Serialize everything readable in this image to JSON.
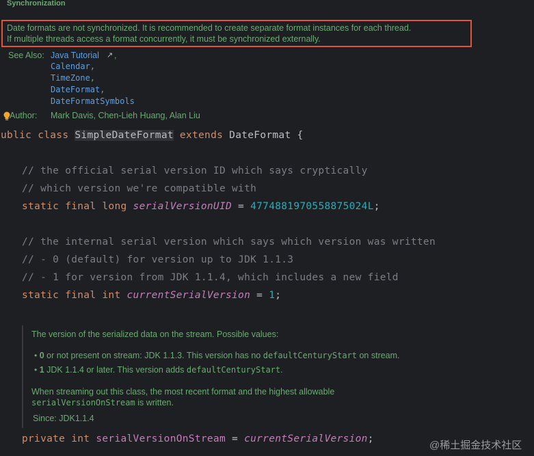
{
  "top_doc": {
    "section_title": "Synchronization",
    "highlight_line1": "Date formats are not synchronized. It is recommended to create separate format instances for each thread.",
    "highlight_line2": "If multiple threads access a format concurrently, it must be synchronized externally.",
    "see_also_label": "See Also:",
    "links": [
      "Java Tutorial",
      "Calendar",
      "TimeZone",
      "DateFormat",
      "DateFormatSymbols"
    ],
    "external_arrow": "↗",
    "comma": ",",
    "author_label": "Author:",
    "author_value": "Mark Davis, Chen-Lieh Huang, Alan Liu"
  },
  "code": {
    "class_kw1": "public",
    "class_kw2": "class",
    "class_name": "SimpleDateFormat",
    "extends_kw": "extends",
    "super_name": "DateFormat",
    "brace": "{",
    "c1": "// the official serial version ID which says cryptically",
    "c2": "// which version we're compatible with",
    "f1_mods": "static final long",
    "f1_name": "serialVersionUID",
    "f1_eq": " = ",
    "f1_val": "4774881970558875024L",
    "semi": ";",
    "c3": "// the internal serial version which says which version was written",
    "c4": "// - 0 (default) for version up to JDK 1.1.3",
    "c5": "// - 1 for version from JDK 1.1.4, which includes a new field",
    "f2_mods": "static final int",
    "f2_name": "currentSerialVersion",
    "f2_eq": " = ",
    "f2_val": "1",
    "f3_mods": "private int",
    "f3_name": "serialVersionOnStream",
    "f3_eq": " = ",
    "f3_val": "currentSerialVersion"
  },
  "bottom_doc": {
    "intro": "The version of the serialized data on the stream. Possible values:",
    "b1_num": "0",
    "b1_text": " or not present on stream: JDK 1.1.3. This version has no ",
    "b1_code": "defaultCenturyStart",
    "b1_tail": " on stream.",
    "b2_num": "1",
    "b2_text": " JDK 1.1.4 or later. This version adds ",
    "b2_code": "defaultCenturyStart",
    "b2_tail": ".",
    "para_line1": "When streaming out this class, the most recent format and the highest allowable",
    "para_code": "serialVersionOnStream",
    "para_tail": " is written.",
    "since": "Since: JDK1.1.4"
  },
  "watermark": "@稀土掘金技术社区"
}
